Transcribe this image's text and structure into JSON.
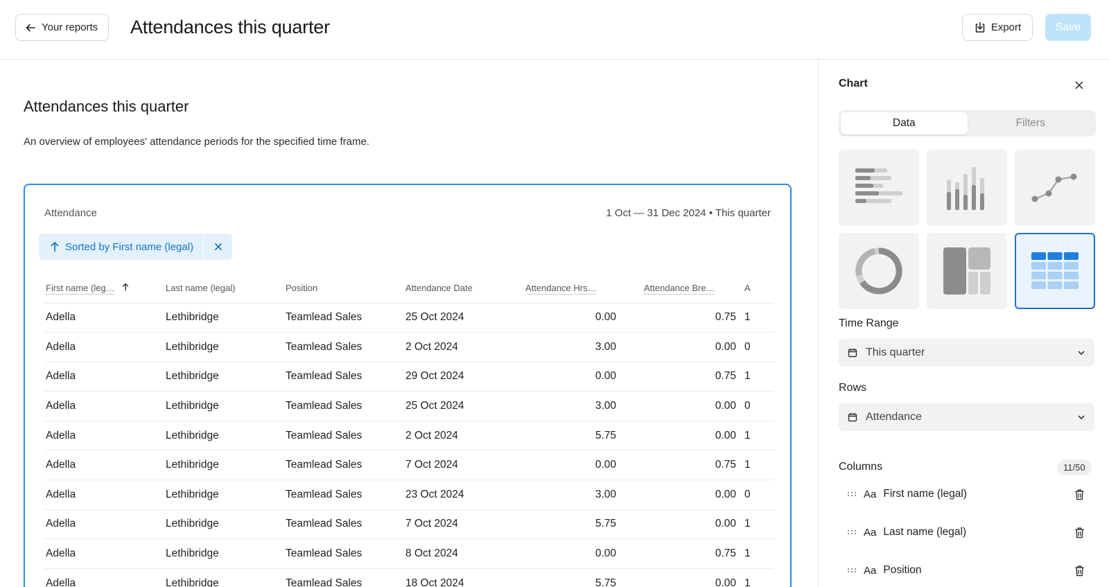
{
  "header": {
    "back_label": "Your reports",
    "title": "Attendances this quarter",
    "export_label": "Export",
    "save_label": "Save"
  },
  "report": {
    "title": "Attendances this quarter",
    "description": "An overview of employees' attendance periods for the specified time frame.",
    "card_label": "Attendance",
    "date_range": "1 Oct — 31 Dec 2024 • This quarter",
    "sort_chip": "Sorted by First name (legal)"
  },
  "table": {
    "columns": [
      "First name (leg…",
      "Last name (legal)",
      "Position",
      "Attendance Date",
      "Attendance Hrs…",
      "Attendance Bre…",
      "A"
    ],
    "rows": [
      [
        "Adella",
        "Lethibridge",
        "Teamlead Sales",
        "25 Oct 2024",
        "0.00",
        "0.75",
        "1"
      ],
      [
        "Adella",
        "Lethibridge",
        "Teamlead Sales",
        "2 Oct 2024",
        "3.00",
        "0.00",
        "0"
      ],
      [
        "Adella",
        "Lethibridge",
        "Teamlead Sales",
        "29 Oct 2024",
        "0.00",
        "0.75",
        "1"
      ],
      [
        "Adella",
        "Lethibridge",
        "Teamlead Sales",
        "25 Oct 2024",
        "3.00",
        "0.00",
        "0"
      ],
      [
        "Adella",
        "Lethibridge",
        "Teamlead Sales",
        "2 Oct 2024",
        "5.75",
        "0.00",
        "1"
      ],
      [
        "Adella",
        "Lethibridge",
        "Teamlead Sales",
        "7 Oct 2024",
        "0.00",
        "0.75",
        "1"
      ],
      [
        "Adella",
        "Lethibridge",
        "Teamlead Sales",
        "23 Oct 2024",
        "3.00",
        "0.00",
        "0"
      ],
      [
        "Adella",
        "Lethibridge",
        "Teamlead Sales",
        "7 Oct 2024",
        "5.75",
        "0.00",
        "1"
      ],
      [
        "Adella",
        "Lethibridge",
        "Teamlead Sales",
        "8 Oct 2024",
        "0.00",
        "0.75",
        "1"
      ],
      [
        "Adella",
        "Lethibridge",
        "Teamlead Sales",
        "18 Oct 2024",
        "5.75",
        "0.00",
        "1"
      ]
    ]
  },
  "sidebar": {
    "title": "Chart",
    "tabs": [
      "Data",
      "Filters"
    ],
    "active_tab": "Data",
    "chart_types": [
      "horizontal-bar-chart-icon",
      "vertical-bar-chart-icon",
      "line-chart-icon",
      "donut-chart-icon",
      "treemap-chart-icon",
      "table-chart-icon"
    ],
    "selected_chart_type": "table-chart-icon",
    "time_range_label": "Time Range",
    "time_range_value": "This quarter",
    "rows_label": "Rows",
    "rows_value": "Attendance",
    "columns_label": "Columns",
    "columns_count": "11/50",
    "column_items": [
      {
        "type": "Aa",
        "label": "First name (legal)"
      },
      {
        "type": "Aa",
        "label": "Last name (legal)"
      },
      {
        "type": "Aa",
        "label": "Position"
      }
    ]
  },
  "colors": {
    "accent": "#2d8ae6",
    "chip_bg": "#e3f1fd",
    "chip_text": "#1673c8",
    "save_disabled": "#bfe3fb",
    "tile_bg": "#f2f2f2"
  }
}
